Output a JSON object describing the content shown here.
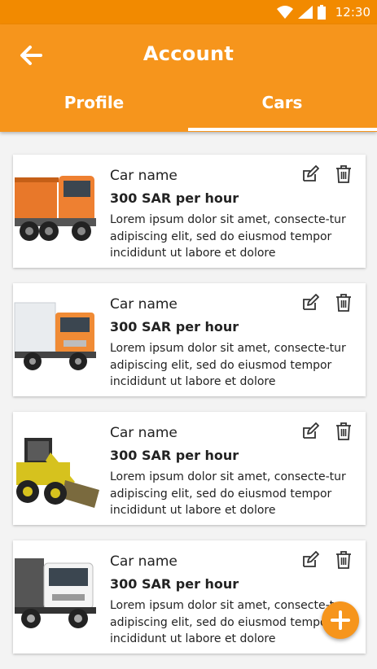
{
  "status_bar": {
    "time": "12:30"
  },
  "header": {
    "title": "Account"
  },
  "tabs": [
    {
      "label": "Profile",
      "active": false
    },
    {
      "label": "Cars",
      "active": true
    }
  ],
  "cars": [
    {
      "name": "Car name",
      "price": "300 SAR per hour",
      "description": "Lorem ipsum dolor sit amet, consecte-tur adipiscing elit, sed do eiusmod tempor incididunt ut labore et dolore",
      "image": "orange-dump-truck"
    },
    {
      "name": "Car name",
      "price": "300 SAR per hour",
      "description": "Lorem ipsum dolor sit amet, consecte-tur adipiscing elit, sed do eiusmod tempor incididunt ut labore et dolore",
      "image": "orange-box-truck"
    },
    {
      "name": "Car name",
      "price": "300 SAR per hour",
      "description": "Lorem ipsum dolor sit amet, consecte-tur adipiscing elit, sed do eiusmod tempor incididunt ut labore et dolore",
      "image": "yellow-skid-steer-loader"
    },
    {
      "name": "Car name",
      "price": "300 SAR per hour",
      "description": "Lorem ipsum dolor sit amet, consecte-tur adipiscing elit, sed do eiusmod tempor incididunt ut labore et dolore",
      "image": "white-cargo-truck"
    }
  ],
  "colors": {
    "accent": "#f6951c",
    "status_bar": "#f28a00",
    "background": "#f3f3f3"
  },
  "icons": [
    "wifi-icon",
    "signal-icon",
    "battery-icon",
    "back-arrow-icon",
    "edit-icon",
    "trash-icon",
    "plus-icon"
  ]
}
